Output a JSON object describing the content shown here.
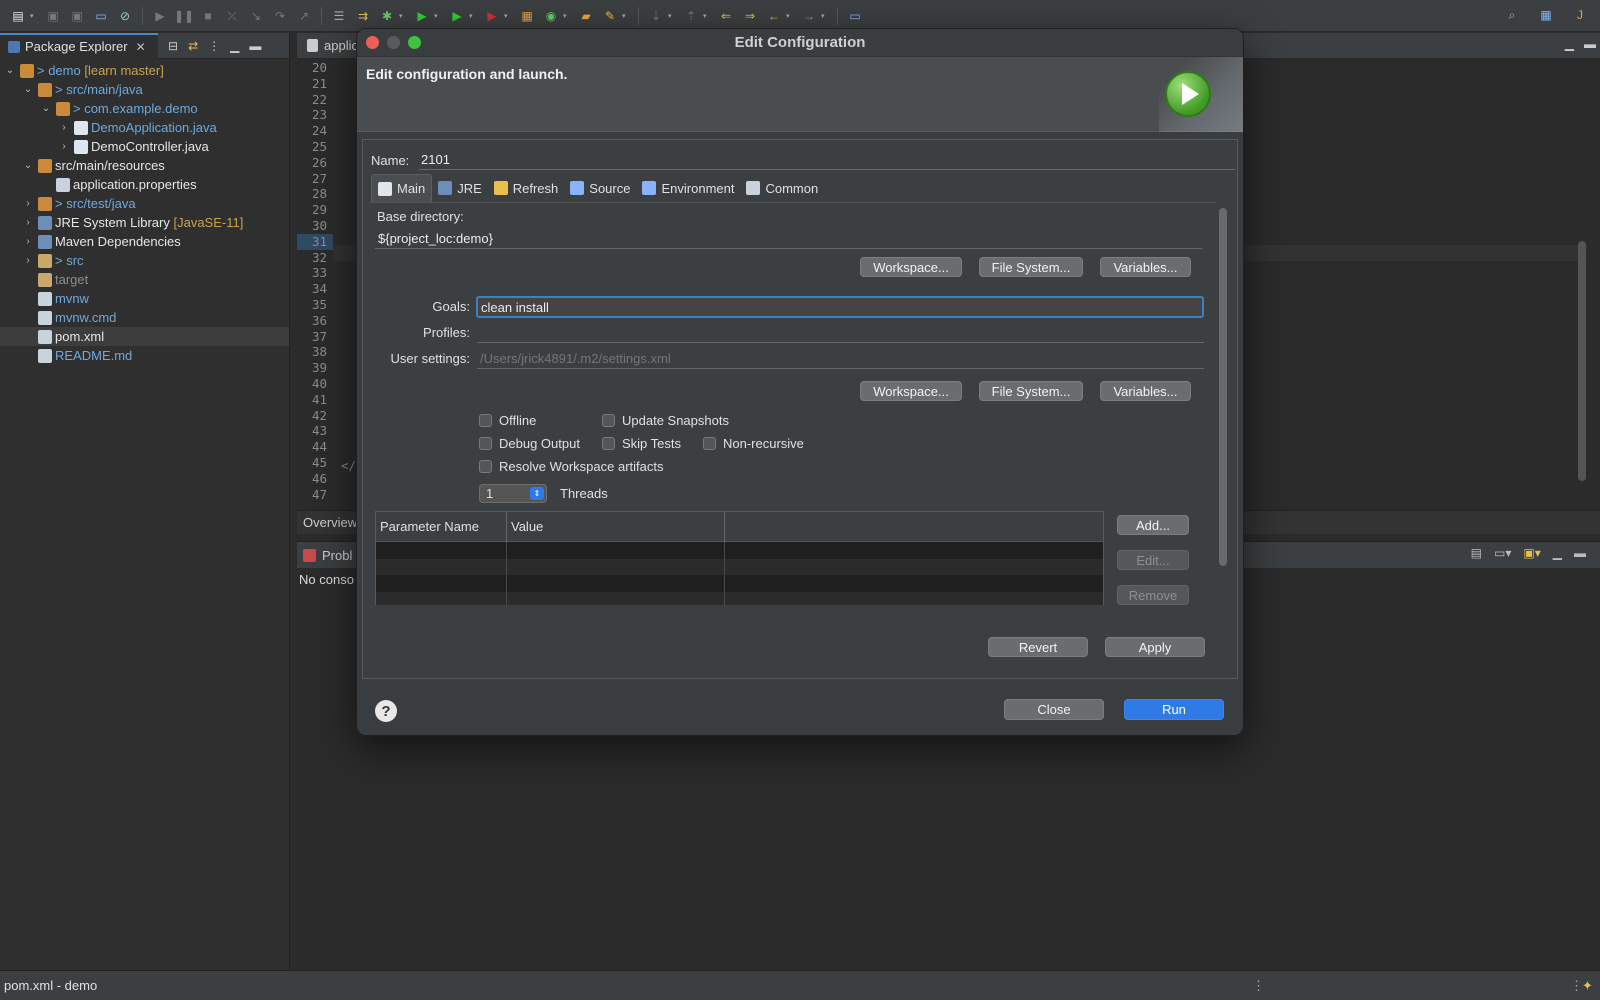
{
  "toolbar": {
    "icons": [
      "new-icon",
      "save-icon",
      "save-all-icon",
      "terminal-icon",
      "skip-breakpoints-icon",
      "resume-icon",
      "suspend-icon",
      "terminate-icon",
      "disconnect-icon",
      "step-into-icon",
      "step-over-icon",
      "step-return-icon",
      "open-type-icon",
      "debug-icon",
      "run-icon",
      "coverage-icon",
      "external-tools-icon",
      "new-java-project-icon",
      "new-class-icon",
      "open-folder-icon",
      "pen-icon",
      "annotation-icon",
      "back-icon",
      "forward-icon",
      "search-icon",
      "perspective-icon",
      "java-perspective-icon"
    ]
  },
  "package_explorer": {
    "tab_label": "Package Explorer",
    "tree": [
      {
        "indent": 0,
        "arrow": "⌄",
        "label": "> demo",
        "suffix": " [learn master]",
        "color": "blue",
        "icon": "project-icon"
      },
      {
        "indent": 1,
        "arrow": "⌄",
        "label": "> src/main/java",
        "suffix": "",
        "color": "blue",
        "icon": "source-folder-icon"
      },
      {
        "indent": 2,
        "arrow": "⌄",
        "label": "> com.example.demo",
        "suffix": "",
        "color": "blue",
        "icon": "package-icon"
      },
      {
        "indent": 3,
        "arrow": "›",
        "label": "DemoApplication.java",
        "suffix": "",
        "color": "blue",
        "icon": "java-file-icon"
      },
      {
        "indent": 3,
        "arrow": "›",
        "label": "DemoController.java",
        "suffix": "",
        "color": "white",
        "icon": "java-file-icon"
      },
      {
        "indent": 1,
        "arrow": "⌄",
        "label": "src/main/resources",
        "suffix": "",
        "color": "white",
        "icon": "source-folder-icon"
      },
      {
        "indent": 2,
        "arrow": "",
        "label": "application.properties",
        "suffix": "",
        "color": "white",
        "icon": "properties-file-icon"
      },
      {
        "indent": 1,
        "arrow": "›",
        "label": "> src/test/java",
        "suffix": "",
        "color": "blue",
        "icon": "source-folder-icon"
      },
      {
        "indent": 1,
        "arrow": "›",
        "label": "JRE System Library",
        "suffix": " [JavaSE-11]",
        "color": "white",
        "icon": "library-icon"
      },
      {
        "indent": 1,
        "arrow": "›",
        "label": "Maven Dependencies",
        "suffix": "",
        "color": "white",
        "icon": "library-icon"
      },
      {
        "indent": 1,
        "arrow": "›",
        "label": "> src",
        "suffix": "",
        "color": "blue",
        "icon": "folder-icon"
      },
      {
        "indent": 1,
        "arrow": "",
        "label": "target",
        "suffix": "",
        "color": "gray",
        "icon": "folder-icon"
      },
      {
        "indent": 1,
        "arrow": "",
        "label": "mvnw",
        "suffix": "",
        "color": "blue",
        "icon": "file-icon"
      },
      {
        "indent": 1,
        "arrow": "",
        "label": "mvnw.cmd",
        "suffix": "",
        "color": "blue",
        "icon": "file-icon"
      },
      {
        "indent": 1,
        "arrow": "",
        "label": "pom.xml",
        "suffix": "",
        "color": "white",
        "icon": "xml-file-icon",
        "selected": true
      },
      {
        "indent": 1,
        "arrow": "",
        "label": "README.md",
        "suffix": "",
        "color": "blue",
        "icon": "markdown-file-icon"
      }
    ]
  },
  "editor": {
    "tab_label": "applic",
    "line_numbers": [
      "20",
      "21",
      "22",
      "23",
      "24",
      "25",
      "26",
      "27",
      "28",
      "29",
      "30",
      "31",
      "32",
      "33",
      "34",
      "35",
      "36",
      "37",
      "38",
      "39",
      "40",
      "41",
      "42",
      "43",
      "44",
      "45",
      "46",
      "47"
    ],
    "folded_lines": [
      "20",
      "25",
      "31",
      "37",
      "38",
      "39"
    ],
    "code_line_46": "</",
    "overview_tab": "Overview"
  },
  "console": {
    "tab_label": "Probl",
    "text": "No conso"
  },
  "statusbar": {
    "text": "pom.xml - demo"
  },
  "dialog": {
    "title": "Edit Configuration",
    "banner_message": "Edit configuration and launch.",
    "name_label": "Name:",
    "name_value": "2101",
    "tabs": [
      {
        "label": "Main",
        "icon": "main-tab-icon",
        "active": true
      },
      {
        "label": "JRE",
        "icon": "jre-tab-icon",
        "active": false
      },
      {
        "label": "Refresh",
        "icon": "refresh-tab-icon",
        "active": false
      },
      {
        "label": "Source",
        "icon": "source-tab-icon",
        "active": false
      },
      {
        "label": "Environment",
        "icon": "environment-tab-icon",
        "active": false
      },
      {
        "label": "Common",
        "icon": "common-tab-icon",
        "active": false
      }
    ],
    "main": {
      "base_dir_label": "Base directory:",
      "base_dir_value": "${project_loc:demo}",
      "workspace_btn": "Workspace...",
      "filesystem_btn": "File System...",
      "variables_btn": "Variables...",
      "goals_label": "Goals:",
      "goals_value": "clean install",
      "profiles_label": "Profiles:",
      "profiles_value": "",
      "user_settings_label": "User settings:",
      "user_settings_placeholder": "/Users/jrick4891/.m2/settings.xml",
      "workspace_btn2": "Workspace...",
      "filesystem_btn2": "File System...",
      "variables_btn2": "Variables...",
      "checkboxes": {
        "offline": "Offline",
        "update_snapshots": "Update Snapshots",
        "debug_output": "Debug Output",
        "skip_tests": "Skip Tests",
        "non_recursive": "Non-recursive",
        "resolve_workspace": "Resolve Workspace artifacts"
      },
      "threads_value": "1",
      "threads_label": "Threads",
      "param_columns": [
        "Parameter Name",
        "Value"
      ],
      "add_btn": "Add...",
      "edit_btn": "Edit...",
      "remove_btn": "Remove"
    },
    "revert_btn": "Revert",
    "apply_btn": "Apply",
    "close_btn": "Close",
    "run_btn": "Run",
    "help_icon": "?"
  }
}
